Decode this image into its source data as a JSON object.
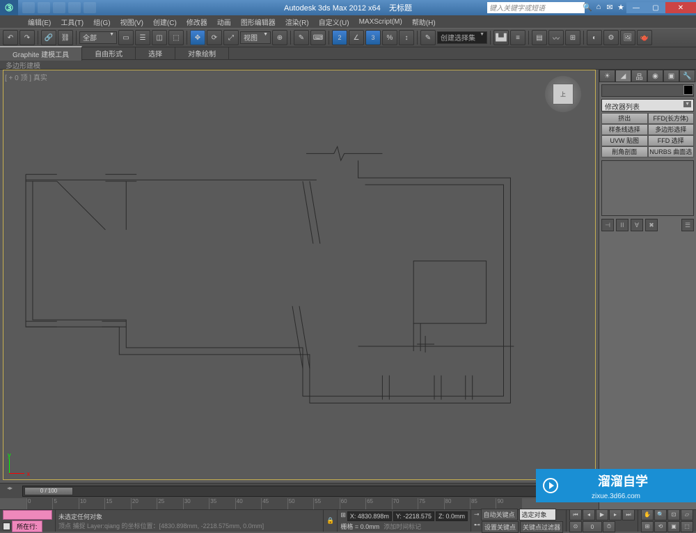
{
  "app": {
    "title": "Autodesk 3ds Max  2012 x64",
    "doc": "无标题",
    "search_placeholder": "键入关键字或短语"
  },
  "menu": {
    "items": [
      "编辑(E)",
      "工具(T)",
      "组(G)",
      "视图(V)",
      "创建(C)",
      "修改器",
      "动画",
      "图形编辑器",
      "渲染(R)",
      "自定义(U)",
      "MAXScript(M)",
      "帮助(H)"
    ]
  },
  "toolbar": {
    "filter_label": "全部",
    "view_label": "视图",
    "selection_set": "创建选择集"
  },
  "ribbon": {
    "tabs": [
      "Graphite 建模工具",
      "自由形式",
      "选择",
      "对象绘制"
    ],
    "subheader": "多边形建模"
  },
  "viewport": {
    "label": "[ + 0 顶 ] 真实",
    "viewcube": "上"
  },
  "modpanel": {
    "modifier_list": "修改器列表",
    "buttons": [
      "挤出",
      "FFD(长方体)",
      "样条线选择",
      "多边形选择",
      "UVW 贴图",
      "FFD 选择",
      "削角剖面",
      "NURBS 曲面选择"
    ]
  },
  "timeline": {
    "frame": "0 / 100",
    "ticks": [
      "0",
      "5",
      "10",
      "15",
      "20",
      "25",
      "30",
      "35",
      "40",
      "45",
      "50",
      "55",
      "60",
      "65",
      "70",
      "75",
      "80",
      "85",
      "90"
    ]
  },
  "status": {
    "layer_label": "所在行:",
    "selection": "未选定任何对象",
    "snap_line": "顶点 捕捉 Layer:qiang 的坐标位置：[4830.898mm, -2218.575mm, 0.0mm]",
    "x": "X: 4830.898m",
    "y": "Y: -2218.575",
    "z": "Z: 0.0mm",
    "grid": "栅格 = 0.0mm",
    "timetag": "添加时间标记",
    "autokey": "自动关键点",
    "selected": "选定对象",
    "setkey": "设置关键点",
    "filter": "关键点过滤器"
  },
  "watermark": {
    "main": "溜溜自学",
    "sub": "zixue.3d66.com"
  }
}
